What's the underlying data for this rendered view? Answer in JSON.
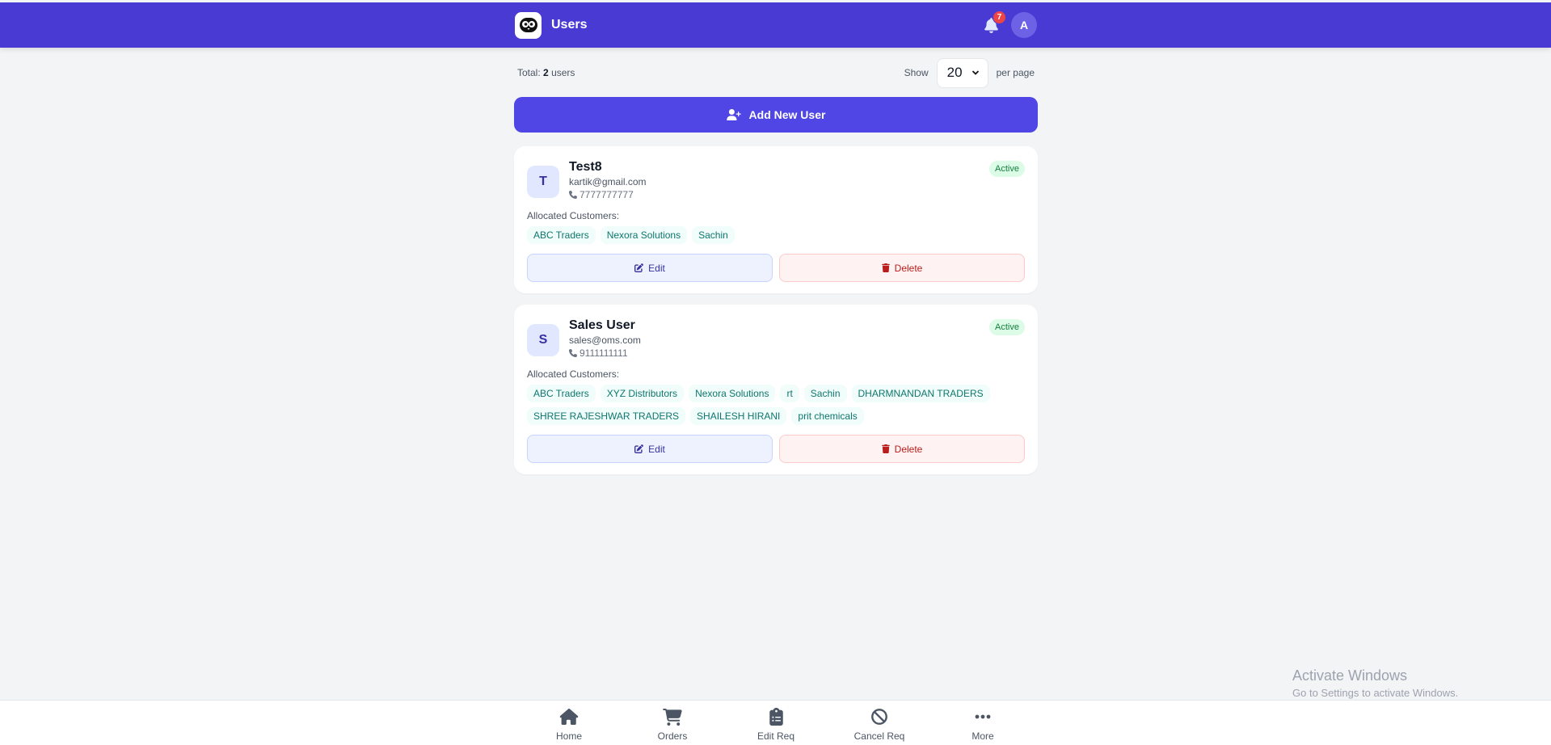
{
  "header": {
    "title": "Users",
    "notification_count": "7",
    "avatar_initial": "A"
  },
  "meta": {
    "total_prefix": "Total:",
    "total_count": "2",
    "total_suffix": "users",
    "show_label": "Show",
    "per_page_value": "20",
    "per_page_label": "per page"
  },
  "add_button": {
    "label": "Add New User"
  },
  "users": [
    {
      "initial": "T",
      "name": "Test8",
      "email": "kartik@gmail.com",
      "phone": "7777777777",
      "status": "Active",
      "allocated_label": "Allocated Customers:",
      "customers": [
        "ABC Traders",
        "Nexora Solutions",
        "Sachin"
      ],
      "edit_label": "Edit",
      "delete_label": "Delete"
    },
    {
      "initial": "S",
      "name": "Sales User",
      "email": "sales@oms.com",
      "phone": "9111111111",
      "status": "Active",
      "allocated_label": "Allocated Customers:",
      "customers": [
        "ABC Traders",
        "XYZ Distributors",
        "Nexora Solutions",
        "rt",
        "Sachin",
        "DHARMNANDAN TRADERS",
        "SHREE RAJESHWAR TRADERS",
        "SHAILESH HIRANI",
        "prit chemicals"
      ],
      "edit_label": "Edit",
      "delete_label": "Delete"
    }
  ],
  "bottom_nav": [
    {
      "label": "Home",
      "icon": "home-icon"
    },
    {
      "label": "Orders",
      "icon": "cart-icon"
    },
    {
      "label": "Edit Req",
      "icon": "clipboard-icon"
    },
    {
      "label": "Cancel Req",
      "icon": "ban-icon"
    },
    {
      "label": "More",
      "icon": "dots-icon"
    }
  ],
  "watermark": {
    "line1": "Activate Windows",
    "line2": "Go to Settings to activate Windows."
  },
  "colors": {
    "primary": "#4f46e5",
    "header": "#4a3ad4",
    "active_bg": "#dcfce7",
    "danger": "#b91c1c"
  }
}
